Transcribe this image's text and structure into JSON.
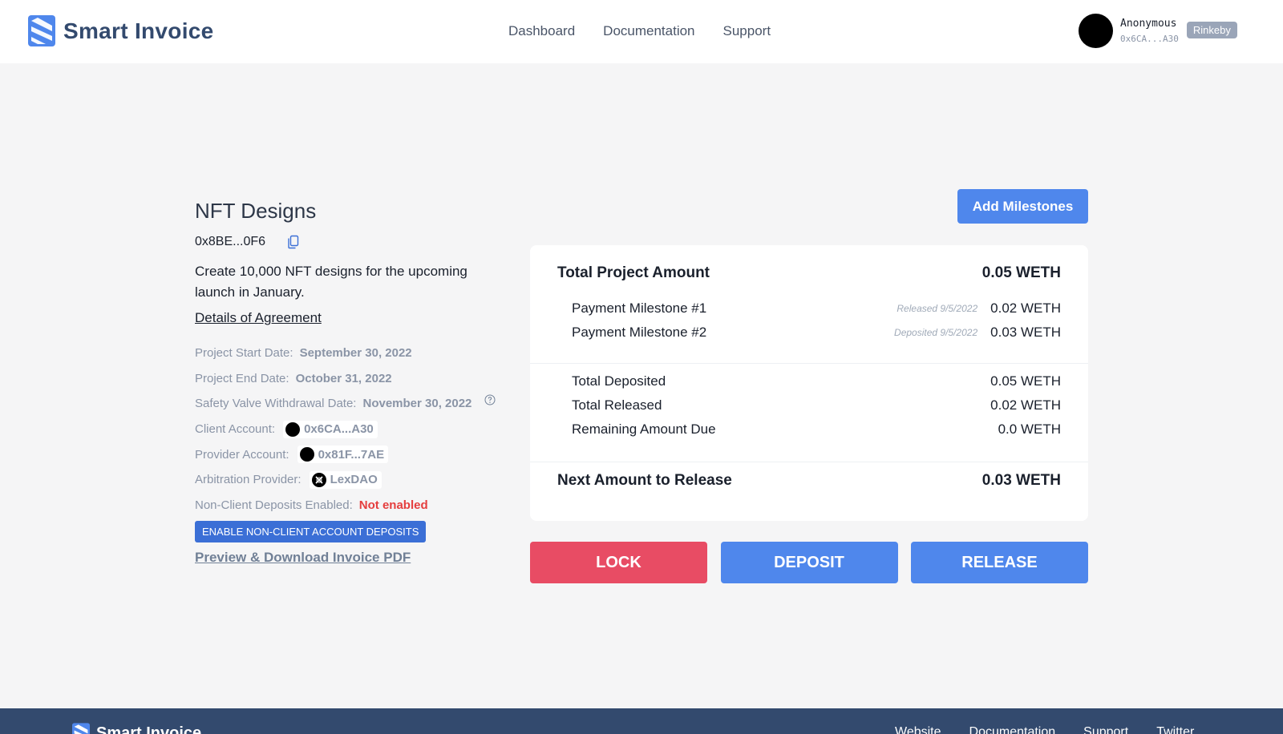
{
  "brand": {
    "name": "Smart Invoice"
  },
  "nav": [
    "Dashboard",
    "Documentation",
    "Support"
  ],
  "account": {
    "name": "Anonymous",
    "address": "0x6CA...A30",
    "network": "Rinkeby"
  },
  "invoice": {
    "title": "NFT Designs",
    "address": "0x8BE...0F6",
    "description": "Create 10,000 NFT designs for the upcoming launch in January.",
    "agreement_link": "Details of Agreement",
    "start_label": "Project Start Date:",
    "start_value": "September 30, 2022",
    "end_label": "Project End Date:",
    "end_value": "October 31, 2022",
    "safety_label": "Safety Valve Withdrawal Date:",
    "safety_value": "November 30, 2022",
    "client_label": "Client Account:",
    "client_value": "0x6CA...A30",
    "provider_label": "Provider Account:",
    "provider_value": "0x81F...7AE",
    "arbitration_label": "Arbitration Provider:",
    "arbitration_value": "LexDAO",
    "nonclient_label": "Non-Client Deposits Enabled:",
    "nonclient_value": "Not enabled",
    "enable_button": "ENABLE NON-CLIENT ACCOUNT DEPOSITS",
    "pdf_link": "Preview & Download Invoice PDF"
  },
  "summary": {
    "add_milestones": "Add Milestones",
    "total_label": "Total Project Amount",
    "total_value": "0.05 WETH",
    "milestones": [
      {
        "label": "Payment Milestone #1",
        "note": "Released 9/5/2022",
        "amount": "0.02 WETH"
      },
      {
        "label": "Payment Milestone #2",
        "note": "Deposited 9/5/2022",
        "amount": "0.03 WETH"
      }
    ],
    "deposited_label": "Total Deposited",
    "deposited_value": "0.05 WETH",
    "released_label": "Total Released",
    "released_value": "0.02 WETH",
    "remaining_label": "Remaining Amount Due",
    "remaining_value": "0.0 WETH",
    "next_label": "Next Amount to Release",
    "next_value": "0.03 WETH"
  },
  "actions": {
    "lock": "LOCK",
    "deposit": "DEPOSIT",
    "release": "RELEASE"
  },
  "footer": {
    "brand": "Smart Invoice",
    "links": [
      "Website",
      "Documentation",
      "Support",
      "Twitter"
    ]
  },
  "colors": {
    "accent": "#4f87ec",
    "lock": "#e84c64",
    "brand": "#334a6e",
    "error": "#e53e3e"
  }
}
